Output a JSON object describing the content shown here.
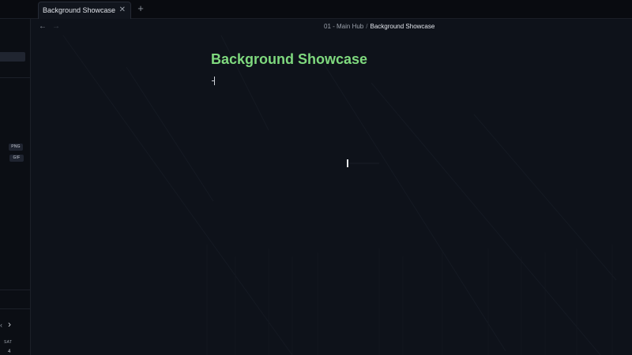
{
  "tabs": [
    {
      "label": "Background Showcase",
      "close_glyph": "✕"
    }
  ],
  "new_tab_glyph": "+",
  "nav": {
    "back_glyph": "←",
    "forward_glyph": "→"
  },
  "breadcrumb": {
    "parent": "01 - Main Hub",
    "separator": "/",
    "current": "Background Showcase"
  },
  "page": {
    "title": "Background Showcase",
    "title_color": "#7fd97e"
  },
  "sidebar": {
    "badges": [
      "PNG",
      "GIF"
    ],
    "calendar": {
      "prev_glyph": "‹",
      "next_glyph": "›",
      "day": "SAT",
      "date": "4"
    }
  },
  "colors": {
    "background": "#0e121a",
    "tabbar": "#090b10",
    "accent_green": "#7fd97e"
  }
}
